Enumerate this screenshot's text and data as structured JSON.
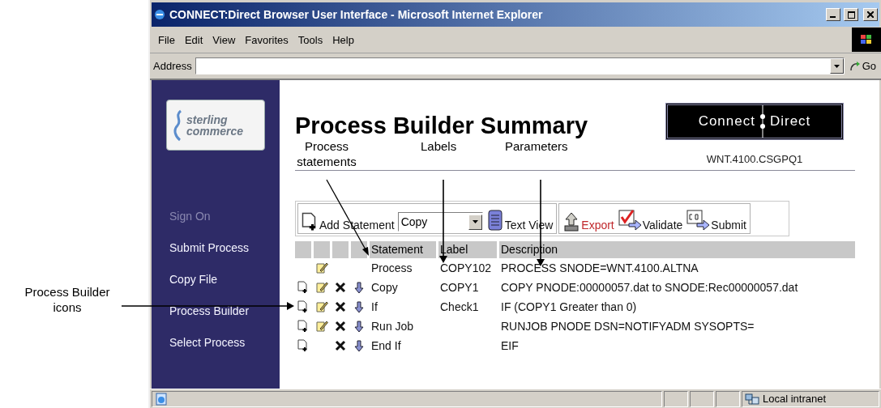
{
  "window": {
    "title": "CONNECT:Direct Browser User Interface - Microsoft Internet Explorer"
  },
  "menu": [
    "File",
    "Edit",
    "View",
    "Favorites",
    "Tools",
    "Help"
  ],
  "address": {
    "label": "Address",
    "go": "Go"
  },
  "sidebar": {
    "logo": [
      "sterling",
      "commerce"
    ],
    "items": [
      {
        "label": "Sign On",
        "disabled": true
      },
      {
        "label": "Submit Process",
        "disabled": false
      },
      {
        "label": "Copy File",
        "disabled": false
      },
      {
        "label": "Process Builder",
        "disabled": false
      },
      {
        "label": "Select Process",
        "disabled": false
      }
    ]
  },
  "header": {
    "title": "Process Builder Summary",
    "brand": [
      "Connect",
      "Direct"
    ],
    "node": "WNT.4100.CSGPQ1"
  },
  "toolbar": {
    "add_statement": "Add Statement",
    "statement_type": "Copy",
    "text_view": "Text View",
    "export": "Export",
    "validate": "Validate",
    "submit": "Submit"
  },
  "table": {
    "columns": [
      "Statement",
      "Label",
      "Description"
    ],
    "rows": [
      {
        "insert": false,
        "edit": true,
        "delete": false,
        "move_down": false,
        "statement": "Process",
        "label": "COPY102",
        "description": "PROCESS SNODE=WNT.4100.ALTNA"
      },
      {
        "insert": true,
        "edit": true,
        "delete": true,
        "move_down": true,
        "statement": "Copy",
        "label": "COPY1",
        "description": "COPY PNODE:00000057.dat to SNODE:Rec00000057.dat"
      },
      {
        "insert": true,
        "edit": true,
        "delete": true,
        "move_down": true,
        "statement": "If",
        "label": "Check1",
        "description": "IF (COPY1 Greater than 0)"
      },
      {
        "insert": true,
        "edit": true,
        "delete": true,
        "move_down": true,
        "statement": "Run Job",
        "label": "",
        "description": "RUNJOB PNODE DSN=NOTIFYADM SYSOPTS="
      },
      {
        "insert": true,
        "edit": false,
        "delete": true,
        "move_down": true,
        "statement": "End If",
        "label": "",
        "description": "EIF"
      }
    ]
  },
  "status_bar": {
    "zone": "Local intranet"
  },
  "callouts": [
    {
      "kind": "diagonal",
      "text": "Process statements"
    },
    {
      "kind": "down",
      "text": "Labels"
    },
    {
      "kind": "down",
      "text": "Parameters"
    },
    {
      "kind": "right",
      "text": "Process Builder icons"
    }
  ]
}
